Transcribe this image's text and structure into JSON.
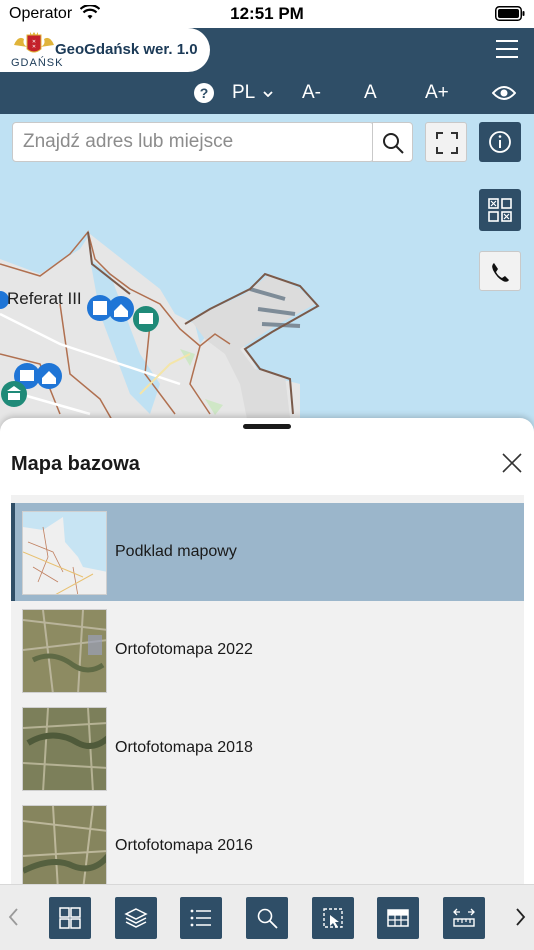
{
  "status_bar": {
    "carrier": "Operator",
    "time": "12:51 PM"
  },
  "header": {
    "city": "GDAŃSK",
    "title": "GeoGdańsk wer. 1.0",
    "toolbar": {
      "language": "PL",
      "font_smaller": "A-",
      "font_normal": "A",
      "font_larger": "A+"
    }
  },
  "map": {
    "search_placeholder": "Znajdź adres lub miejsce",
    "label": "Referat III"
  },
  "basemap_panel": {
    "title": "Mapa bazowa",
    "items": [
      {
        "label": "Podklad mapowy",
        "selected": true
      },
      {
        "label": "Ortofotomapa 2022",
        "selected": false
      },
      {
        "label": "Ortofotomapa 2018",
        "selected": false
      },
      {
        "label": "Ortofotomapa 2016",
        "selected": false
      }
    ]
  },
  "bottom_nav": {
    "buttons": [
      "grid-icon",
      "layers-icon",
      "list-icon",
      "search-icon",
      "select-area-icon",
      "table-icon",
      "measure-icon"
    ]
  },
  "colors": {
    "primary": "#2f4e67",
    "selected_row": "#9bb6cb",
    "water": "#bfe1f3",
    "land": "#e8e8e8"
  }
}
